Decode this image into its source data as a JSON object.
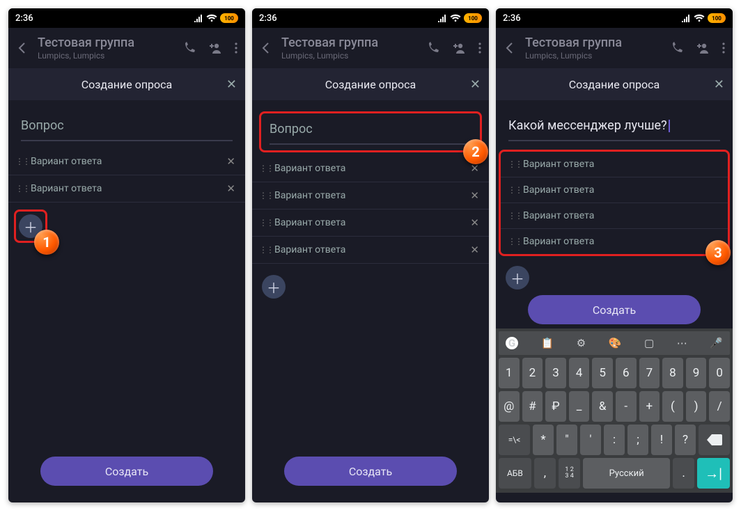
{
  "status": {
    "time": "2:36",
    "battery_label": "100"
  },
  "nav": {
    "title": "Тестовая группа",
    "subtitle": "Lumpics, Lumpics"
  },
  "subheader": {
    "title": "Создание опроса"
  },
  "poll": {
    "question_placeholder": "Вопрос",
    "question_value": "Какой мессенджер лучше?",
    "option_placeholder": "Вариант ответа",
    "create_label": "Создать"
  },
  "badges": {
    "one": "1",
    "two": "2",
    "three": "3"
  },
  "keyboard": {
    "lang_label": "Русский",
    "abc_label": "АБВ",
    "row1": [
      {
        "main": "1",
        "sup": ""
      },
      {
        "main": "2",
        "sup": ""
      },
      {
        "main": "3",
        "sup": ""
      },
      {
        "main": "4",
        "sup": ""
      },
      {
        "main": "5",
        "sup": ""
      },
      {
        "main": "6",
        "sup": ""
      },
      {
        "main": "7",
        "sup": ""
      },
      {
        "main": "8",
        "sup": ""
      },
      {
        "main": "9",
        "sup": ""
      },
      {
        "main": "0",
        "sup": ""
      }
    ],
    "row2": [
      {
        "main": "@",
        "sup": ""
      },
      {
        "main": "#",
        "sup": ""
      },
      {
        "main": "₽",
        "sup": ""
      },
      {
        "main": "_",
        "sup": ""
      },
      {
        "main": "&",
        "sup": ""
      },
      {
        "main": "-",
        "sup": ""
      },
      {
        "main": "+",
        "sup": ""
      },
      {
        "main": "(",
        "sup": ""
      },
      {
        "main": ")",
        "sup": ""
      },
      {
        "main": "/",
        "sup": ""
      }
    ],
    "row3": [
      {
        "main": "*",
        "sup": ""
      },
      {
        "main": "\"",
        "sup": ""
      },
      {
        "main": "'",
        "sup": ""
      },
      {
        "main": ":",
        "sup": ""
      },
      {
        "main": ";",
        "sup": ""
      },
      {
        "main": "!",
        "sup": ""
      },
      {
        "main": "?",
        "sup": ""
      }
    ],
    "symshift": "=\\<",
    "comma": ",",
    "onetwothreefour": "1234",
    "period": "."
  }
}
